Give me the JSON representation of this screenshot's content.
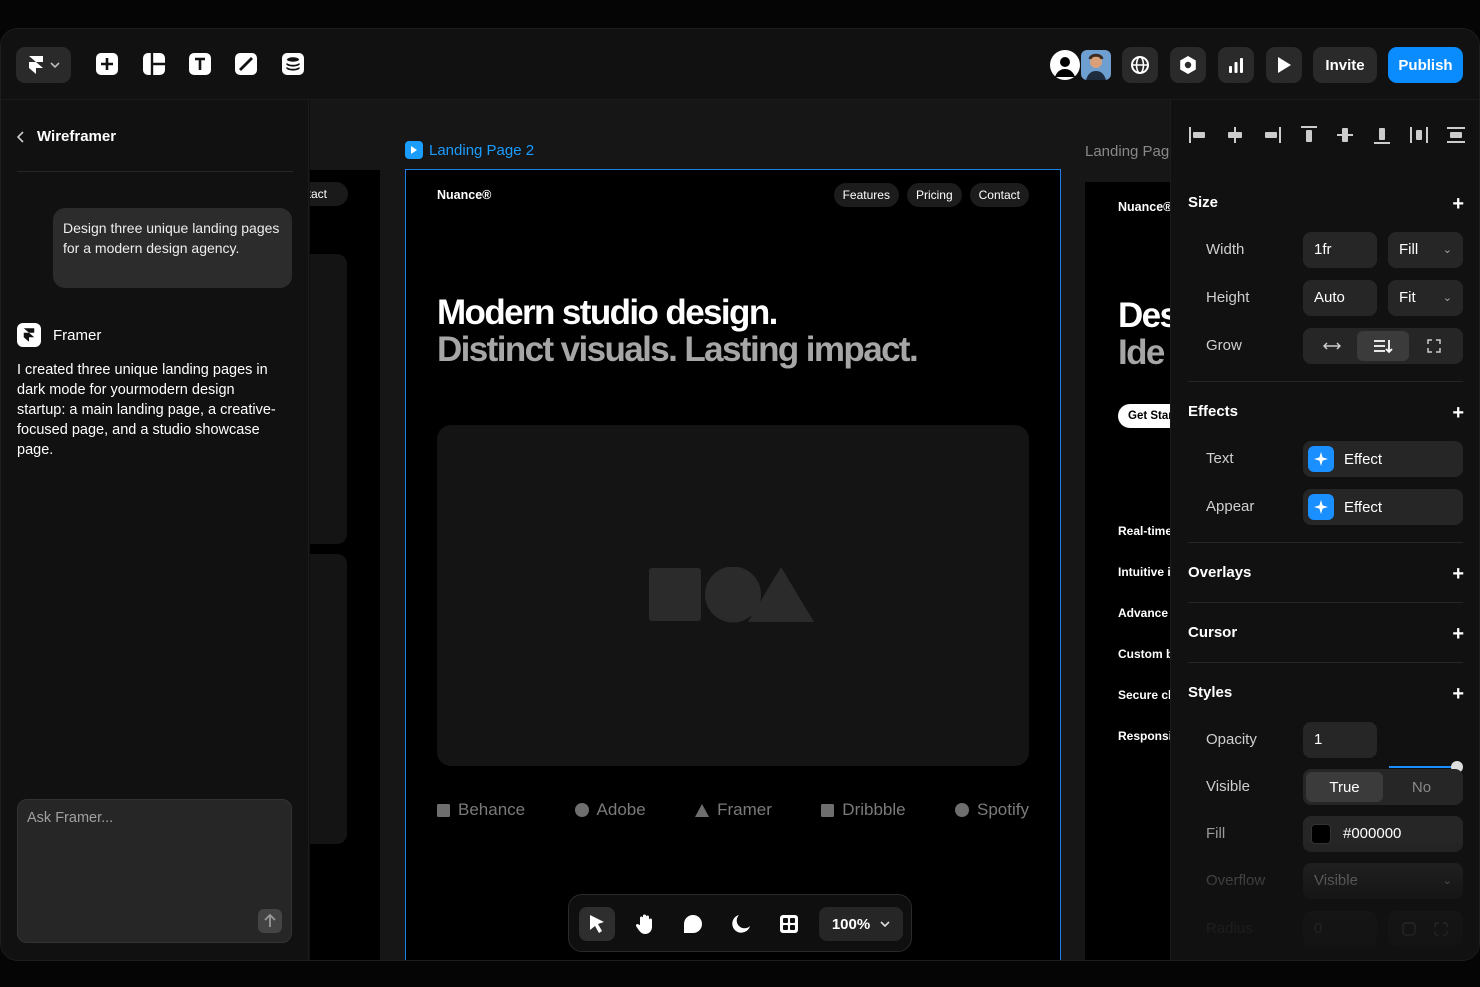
{
  "topbar": {
    "invite_label": "Invite",
    "publish_label": "Publish"
  },
  "chat": {
    "back_title": "Wireframer",
    "user_message": "Design three unique landing pages for a modern design agency.",
    "assistant_name": "Framer",
    "assistant_reply": "I created three unique landing pages in dark mode for yourmodern design startup: a main landing page, a creative-focused page, and a studio showcase page.",
    "input_placeholder": "Ask Framer..."
  },
  "canvas": {
    "prev_nav_label": "ntact",
    "frame_label": "Landing Page 2",
    "frame_label_right": "Landing Pag",
    "main_frame": {
      "brand": "Nuance®",
      "nav": [
        "Features",
        "Pricing",
        "Contact"
      ],
      "headline_line1": "Modern studio design.",
      "headline_line2": "Distinct visuals. Lasting impact.",
      "logos": [
        "Behance",
        "Adobe",
        "Framer",
        "Dribbble",
        "Spotify"
      ]
    },
    "right_frame": {
      "brand": "Nuance®",
      "headline_line1": "Des",
      "headline_line2": "Ide",
      "cta": "Get Star",
      "list": [
        "Real-time",
        "Intuitive i",
        "Advance",
        "Custom b",
        "Secure cl",
        "Responsi"
      ]
    },
    "zoom": "100%"
  },
  "properties": {
    "size": {
      "title": "Size",
      "width_label": "Width",
      "width_value": "1fr",
      "width_mode": "Fill",
      "height_label": "Height",
      "height_value": "Auto",
      "height_mode": "Fit",
      "grow_label": "Grow"
    },
    "effects": {
      "title": "Effects",
      "text_label": "Text",
      "text_value": "Effect",
      "appear_label": "Appear",
      "appear_value": "Effect"
    },
    "overlays_title": "Overlays",
    "cursor_title": "Cursor",
    "styles": {
      "title": "Styles",
      "opacity_label": "Opacity",
      "opacity_value": "1",
      "opacity_level": 1,
      "visible_label": "Visible",
      "visible_true": "True",
      "visible_no": "No",
      "fill_label": "Fill",
      "fill_value": "#000000",
      "overflow_label": "Overflow",
      "overflow_value": "Visible",
      "radius_label": "Radius",
      "radius_value": "0"
    }
  },
  "colors": {
    "accent": "#0a8cff",
    "frame_outline": "#1b7fe6"
  }
}
